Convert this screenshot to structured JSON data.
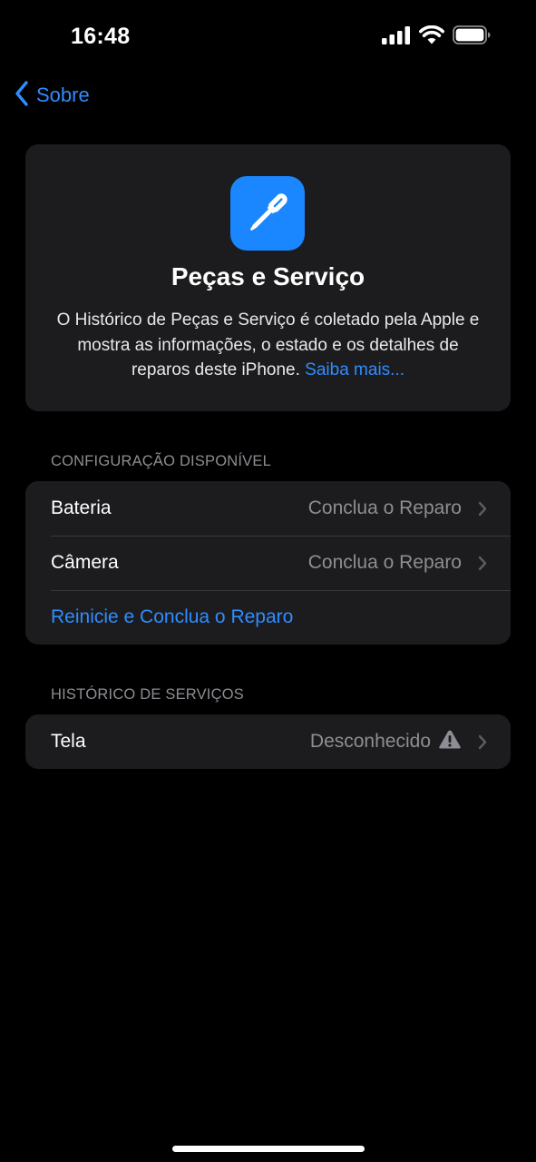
{
  "status_bar": {
    "time": "16:48"
  },
  "nav": {
    "back_label": "Sobre"
  },
  "hero": {
    "icon": "screwdriver-icon",
    "title": "Peças e Serviço",
    "description": "O Histórico de Peças e Serviço é coletado pela Apple e mostra as informações, o estado e os detalhes de reparos deste iPhone.",
    "link_label": "Saiba mais..."
  },
  "sections": {
    "config": {
      "header": "CONFIGURAÇÃO DISPONÍVEL",
      "rows": [
        {
          "label": "Bateria",
          "value": "Conclua o Reparo"
        },
        {
          "label": "Câmera",
          "value": "Conclua o Reparo"
        }
      ],
      "action_label": "Reinicie e Conclua o Reparo"
    },
    "history": {
      "header": "HISTÓRICO DE SERVIÇOS",
      "rows": [
        {
          "label": "Tela",
          "value": "Desconhecido",
          "icon": "warning-icon"
        }
      ]
    }
  },
  "colors": {
    "background": "#000000",
    "card": "#1c1c1e",
    "accent": "#2f8cff",
    "secondary_text": "#8d8d93",
    "separator": "#38383a"
  }
}
